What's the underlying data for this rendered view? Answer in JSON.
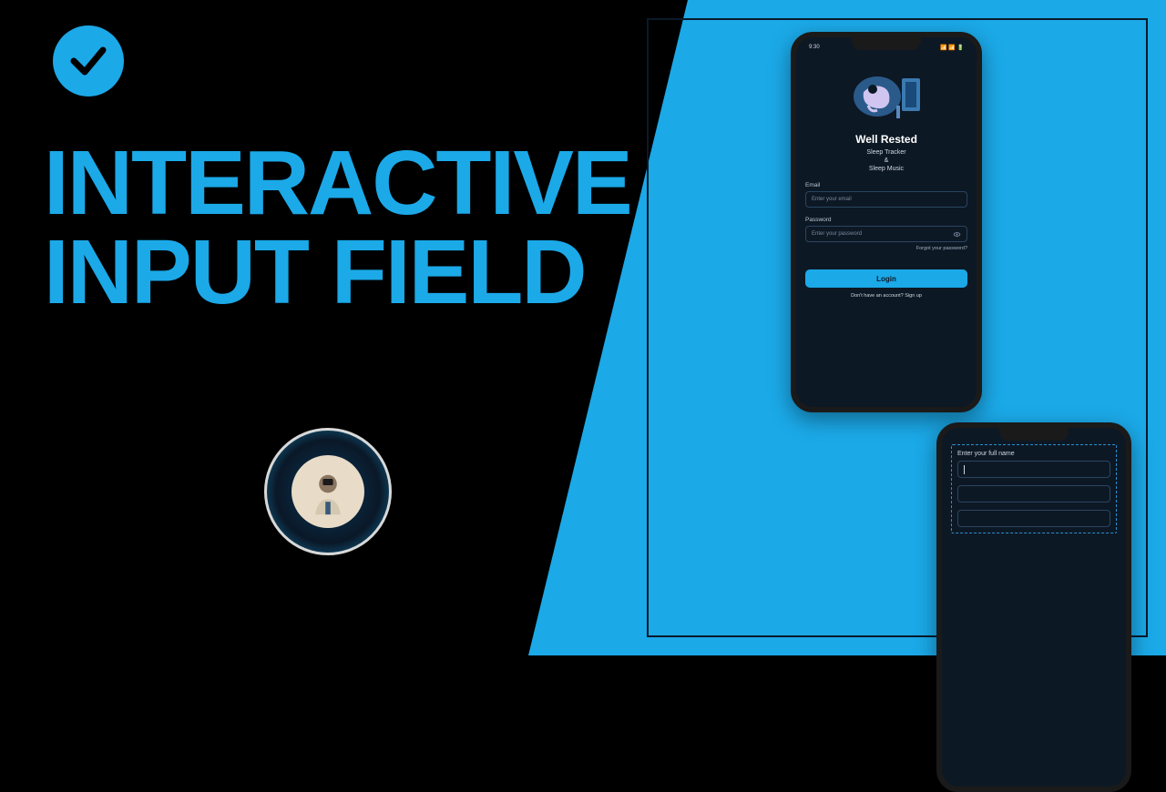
{
  "title": {
    "line1": "INTERACTIVE",
    "line2": "INPUT FIELD"
  },
  "colors": {
    "accent": "#1ba9e8",
    "dark": "#0d1825"
  },
  "phone1": {
    "time": "9:30",
    "signal": "📶 📶 🔋",
    "app_title": "Well Rested",
    "subtitle_line1": "Sleep Tracker",
    "subtitle_line2": "&",
    "subtitle_line3": "Sleep Music",
    "email_label": "Email",
    "email_placeholder": "Enter your email",
    "password_label": "Password",
    "password_placeholder": "Enter your password",
    "forgot": "Forgot your password?",
    "login_button": "Login",
    "signup_prompt": "Don't have an account?",
    "signup_action": "Sign up"
  },
  "phone2": {
    "label": "Enter your full name"
  }
}
